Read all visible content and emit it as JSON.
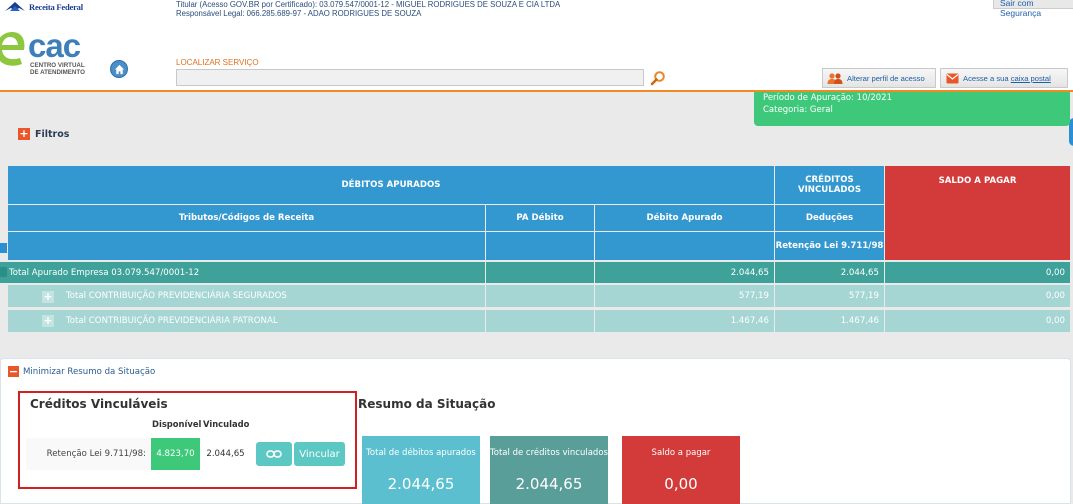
{
  "header": {
    "brand": "Receita Federal",
    "titular_line1": "Titular (Acesso GOV.BR por Certificado): 03.079.547/0001-12 - MIGUEL RODRIGUES DE SOUZA E CIA LTDA",
    "titular_line2": "Responsável Legal: 066.285.689-97 - ADAO RODRIGUES DE SOUZA",
    "sair": "Sair com Segurança",
    "ecac_logo_e": "e",
    "ecac_logo_cac": "cac",
    "ecac_sub1": "CENTRO VIRTUAL",
    "ecac_sub2": "DE ATENDIMENTO",
    "localizar_label": "LOCALIZAR SERVIÇO",
    "localizar_value": "",
    "alterar_perfil": "Alterar perfil de acesso",
    "caixa_prefix": "Acesse a sua ",
    "caixa_link": "caixa postal"
  },
  "info": {
    "periodo": "Período de Apuração: 10/2021",
    "categoria": "Categoria: Geral"
  },
  "filtros": "Filtros",
  "table": {
    "h_debitos": "DÉBITOS APURADOS",
    "h_creditos": "CRÉDITOS VINCULADOS",
    "h_saldo": "SALDO A PAGAR",
    "h_tributos": "Tributos/Códigos de Receita",
    "h_pa": "PA Débito",
    "h_debito_apurado": "Débito Apurado",
    "h_deducoes": "Deduções",
    "h_retencao": "Retenção Lei 9.711/98",
    "rows": [
      {
        "label": "Total Apurado Empresa 03.079.547/0001-12",
        "pa": "",
        "debito": "2.044,65",
        "credito": "2.044,65",
        "saldo": "0,00"
      },
      {
        "label": "Total CONTRIBUIÇÃO PREVIDENCIÁRIA SEGURADOS",
        "pa": "",
        "debito": "577,19",
        "credito": "577,19",
        "saldo": "0,00"
      },
      {
        "label": "Total CONTRIBUIÇÃO PREVIDENCIÁRIA PATRONAL",
        "pa": "",
        "debito": "1.467,46",
        "credito": "1.467,46",
        "saldo": "0,00"
      }
    ]
  },
  "resumo": {
    "minimizar": "Minimizar Resumo da Situação",
    "creditos_title": "Créditos Vinculáveis",
    "col_disponivel": "Disponível",
    "col_vinculado": "Vinculado",
    "credito_label": "Retenção Lei 9.711/98:",
    "disponivel": "4.823,70",
    "vinculado": "2.044,65",
    "vincular": "Vincular",
    "title": "Resumo da Situação",
    "cards": [
      {
        "label": "Total de débitos apurados",
        "value": "2.044,65",
        "color": "#5bbfcf"
      },
      {
        "label": "Total de créditos vinculados",
        "value": "2.044,65",
        "color": "#5a9e9a"
      },
      {
        "label": "Saldo a pagar",
        "value": "0,00",
        "color": "#d33a3a"
      }
    ]
  }
}
